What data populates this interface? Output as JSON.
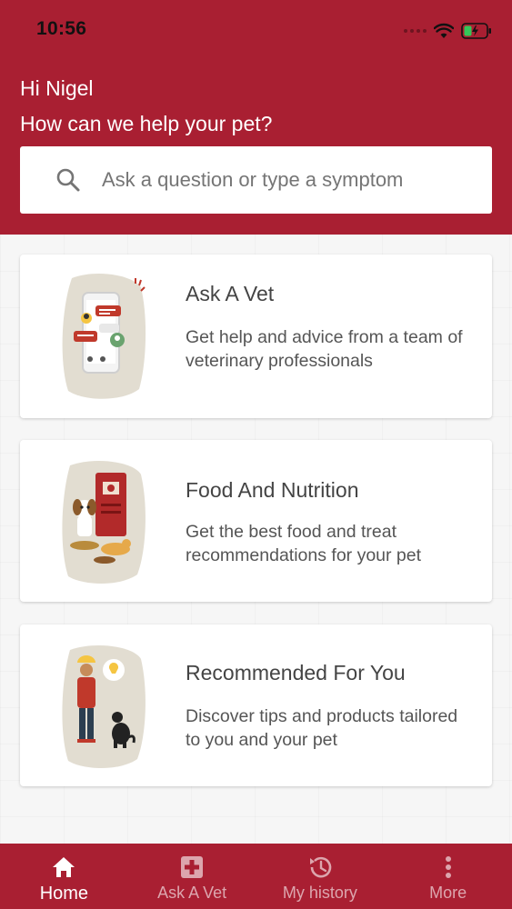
{
  "status_bar": {
    "time": "10:56",
    "icons": [
      "signal-icon",
      "wifi-icon",
      "battery-charging-icon"
    ]
  },
  "header": {
    "greeting": "Hi Nigel",
    "subtitle": "How can we help your pet?"
  },
  "search": {
    "placeholder": "Ask a question or type a symptom",
    "value": "",
    "icon": "search-icon"
  },
  "cards": [
    {
      "title": "Ask A Vet",
      "description": "Get help and advice from a team of veterinary professionals",
      "icon": "phone-chat-illustration"
    },
    {
      "title": "Food And Nutrition",
      "description": "Get the best food and treat recommendations for your pet",
      "icon": "dog-cat-food-illustration"
    },
    {
      "title": "Recommended For You",
      "description": "Discover tips and products tailored to you and your pet",
      "icon": "person-dog-illustration"
    }
  ],
  "bottom_nav": {
    "items": [
      {
        "label": "Home",
        "icon": "home-icon",
        "active": true
      },
      {
        "label": "Ask A Vet",
        "icon": "medical-cross-icon",
        "active": false
      },
      {
        "label": "My history",
        "icon": "history-icon",
        "active": false
      },
      {
        "label": "More",
        "icon": "more-vertical-icon",
        "active": false
      }
    ]
  },
  "colors": {
    "brand": "#a91f32",
    "card_bg": "#ffffff",
    "illustration_bg": "#e2ddd1",
    "text_primary": "#444444",
    "text_secondary": "#555555"
  }
}
